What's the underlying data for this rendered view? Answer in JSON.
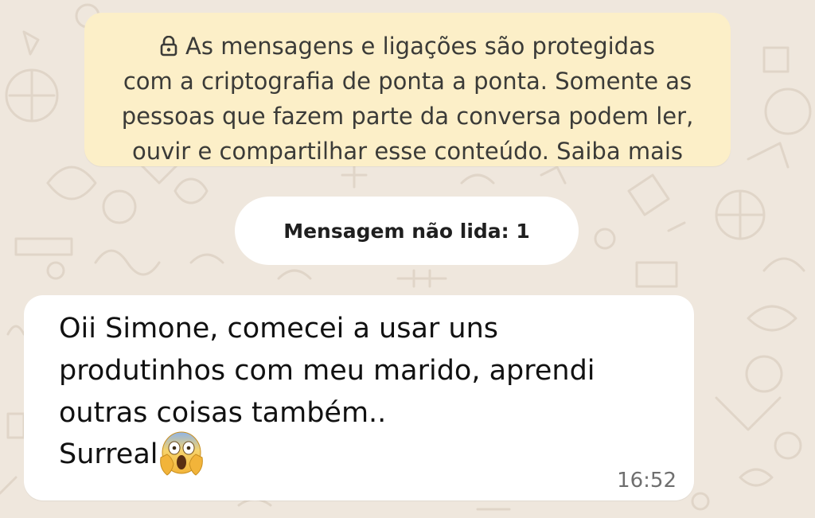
{
  "encryption_notice": {
    "lines": [
      "As mensagens e ligações são protegidas",
      "com a criptografia de ponta a ponta. Somente as",
      "pessoas que fazem parte da conversa podem ler,",
      "ouvir e compartilhar esse conteúdo. Saiba mais"
    ],
    "icon": "lock-icon"
  },
  "unread_label": "Mensagem não lida: 1",
  "message": {
    "lines": [
      "Oii Simone, comecei a usar uns",
      "produtinhos com meu marido, aprendi",
      "outras coisas também.."
    ],
    "last_line": "Surreal",
    "emoji": "face-screaming-in-fear-emoji",
    "time": "16:52"
  },
  "colors": {
    "background": "#efe7dd",
    "banner": "#fcefc8",
    "bubble": "#ffffff",
    "time_text": "#6f6f6f"
  }
}
